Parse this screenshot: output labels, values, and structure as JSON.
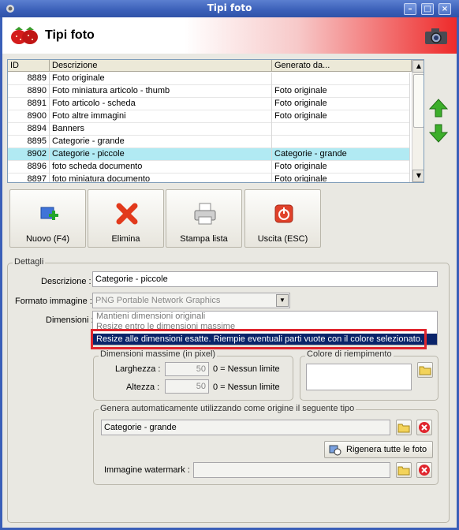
{
  "window": {
    "title": "Tipi foto"
  },
  "header": {
    "title": "Tipi foto"
  },
  "grid": {
    "columns": [
      "ID",
      "Descrizione",
      "Generato da..."
    ],
    "rows": [
      {
        "id": "8889",
        "desc": "Foto originale",
        "gen": ""
      },
      {
        "id": "8890",
        "desc": "Foto miniatura articolo - thumb",
        "gen": "Foto originale"
      },
      {
        "id": "8891",
        "desc": "Foto articolo - scheda",
        "gen": "Foto originale"
      },
      {
        "id": "8900",
        "desc": "Foto altre immagini",
        "gen": "Foto originale"
      },
      {
        "id": "8894",
        "desc": "Banners",
        "gen": ""
      },
      {
        "id": "8895",
        "desc": "Categorie - grande",
        "gen": ""
      },
      {
        "id": "8902",
        "desc": "Categorie - piccole",
        "gen": "Categorie - grande"
      },
      {
        "id": "8896",
        "desc": "foto scheda documento",
        "gen": "Foto originale"
      },
      {
        "id": "8897",
        "desc": "foto miniatura documento",
        "gen": "Foto originale"
      }
    ],
    "selected_index": 6
  },
  "toolbar": {
    "new_label": "Nuovo (F4)",
    "delete_label": "Elimina",
    "print_label": "Stampa lista",
    "exit_label": "Uscita (ESC)"
  },
  "details": {
    "group_label": "Dettagli",
    "descrizione_label": "Descrizione :",
    "descrizione_value": "Categorie - piccole",
    "formato_label": "Formato immagine :",
    "formato_value": "PNG Portable Network Graphics",
    "dimensioni_label": "Dimensioni :",
    "dimensioni_options": [
      "Mantieni dimensioni originali",
      "Resize entro le dimensioni massime",
      "Resize alle dimensioni esatte. Riempie eventuali parti vuote con il colore selezionato."
    ],
    "dimensioni_selected": 2,
    "max_group_label": "Dimensioni massime (in pixel)",
    "larghezza_label": "Larghezza :",
    "larghezza_value": "50",
    "larghezza_hint": "0 = Nessun limite",
    "altezza_label": "Altezza :",
    "altezza_value": "50",
    "altezza_hint": "0 = Nessun limite",
    "colore_label": "Colore di riempimento",
    "genera_group_label": "Genera automaticamente utilizzando come origine il seguente tipo",
    "genera_value": "Categorie - grande",
    "rigenera_label": "Rigenera tutte le foto",
    "watermark_label": "Immagine watermark :",
    "watermark_value": ""
  },
  "colors": {
    "accent": "#3a5fb8",
    "selection": "#b1eaf3",
    "highlight": "#0a246a",
    "callout": "#e0262e"
  }
}
